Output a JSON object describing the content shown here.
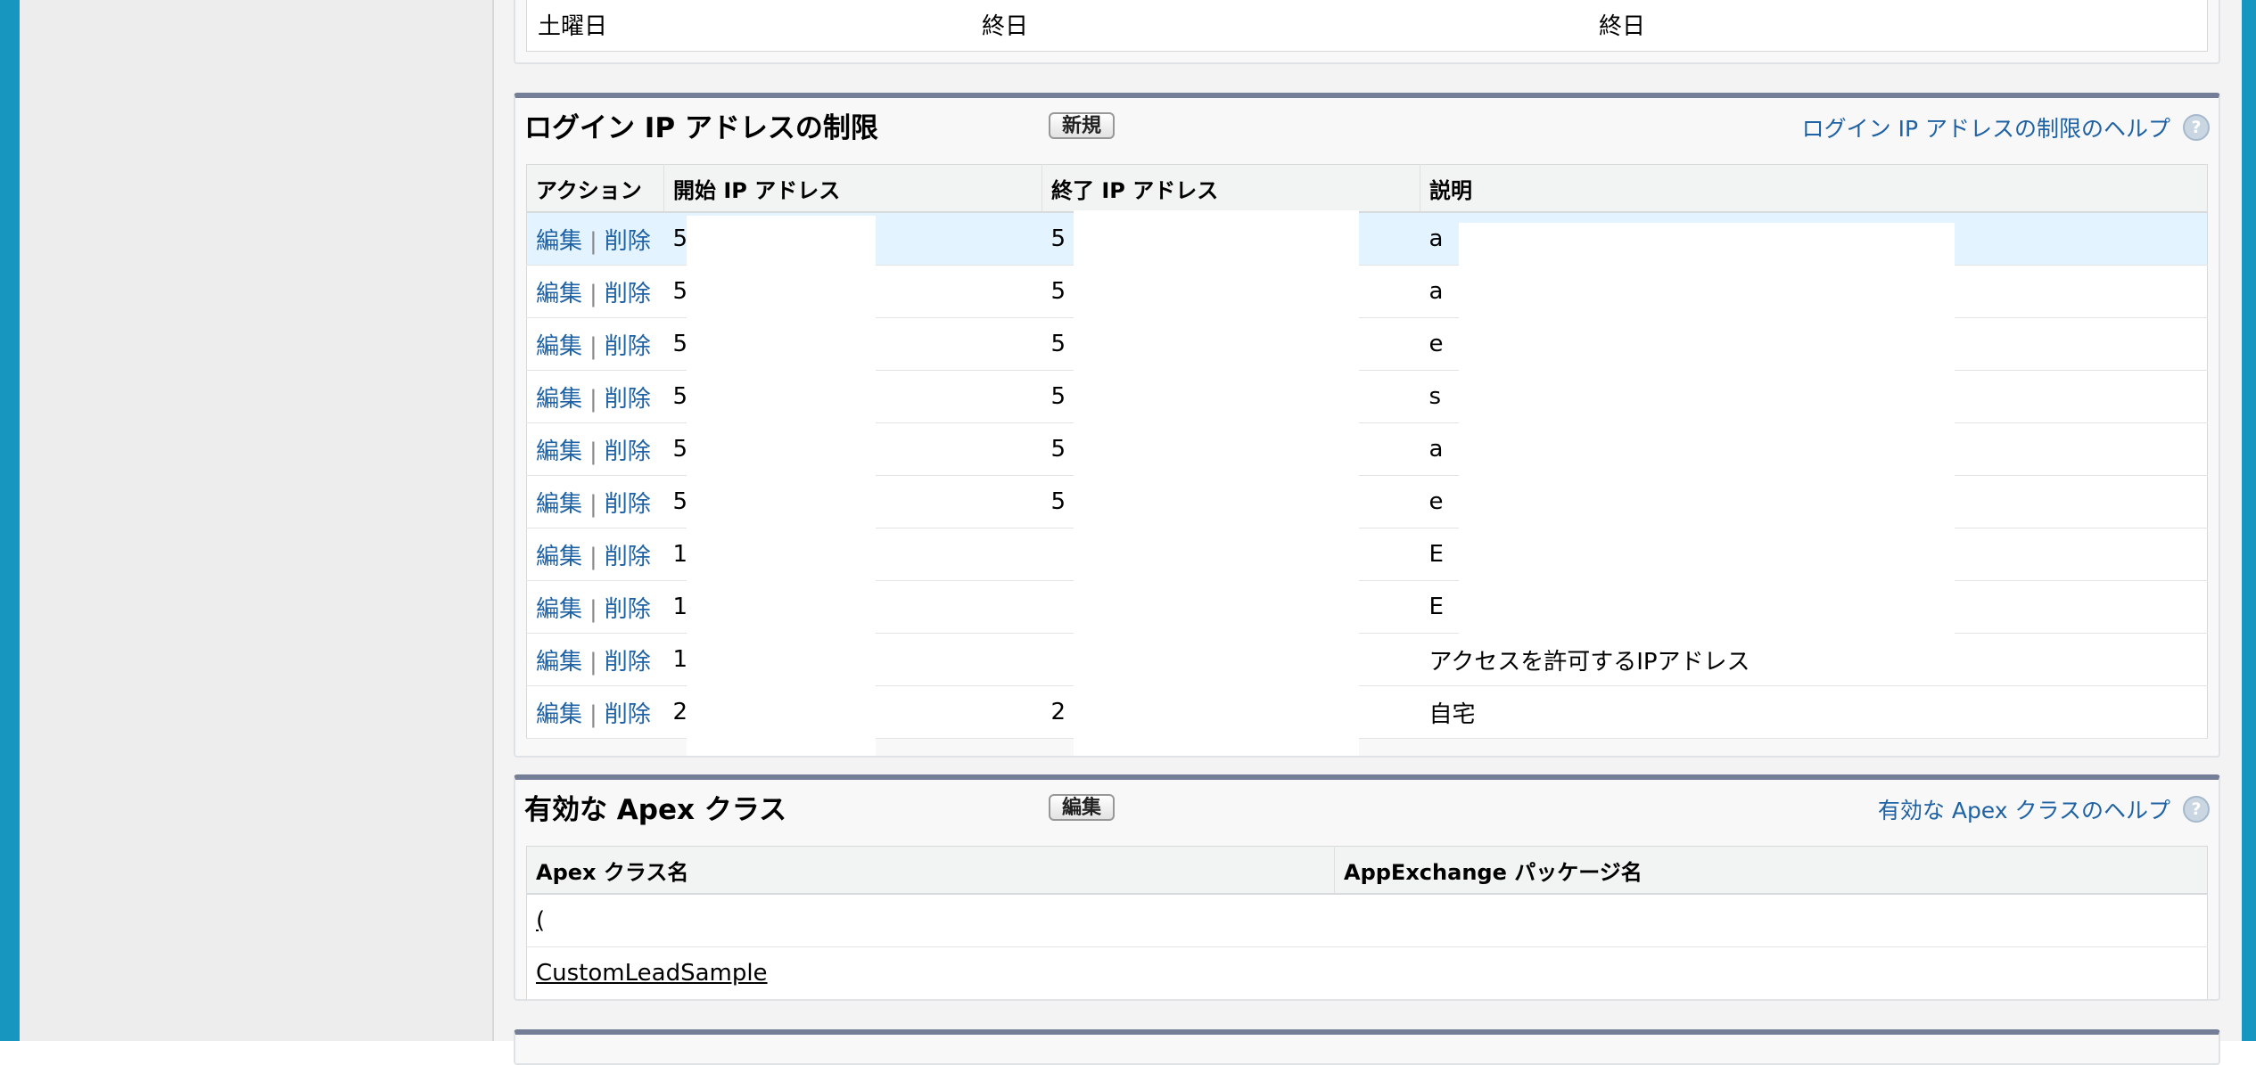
{
  "schedule_row": {
    "day": "土曜日",
    "start": "終日",
    "end": "終日"
  },
  "ip_section": {
    "title": "ログイン IP アドレスの制限",
    "new_button": "新規",
    "help_link": "ログイン IP アドレスの制限のヘルプ",
    "help_icon": "?",
    "columns": [
      "アクション",
      "開始 IP アドレス",
      "終了 IP アドレス",
      "説明"
    ],
    "edit_label": "編集",
    "separator": "|",
    "delete_label": "削除",
    "rows": [
      {
        "start": "5",
        "end": "5",
        "desc": "a"
      },
      {
        "start": "5",
        "end": "5",
        "desc": "a"
      },
      {
        "start": "5",
        "end": "5",
        "desc": "e"
      },
      {
        "start": "5",
        "end": "5",
        "desc": "s"
      },
      {
        "start": "5",
        "end": "5",
        "desc": "a"
      },
      {
        "start": "5",
        "end": "5",
        "desc": "e"
      },
      {
        "start": "1",
        "end": "",
        "desc": "E"
      },
      {
        "start": "1",
        "end": "",
        "desc": "E"
      },
      {
        "start": "1",
        "end": "",
        "desc": "アクセスを許可するIPアドレス"
      },
      {
        "start": "2",
        "end": "2",
        "desc": "自宅"
      }
    ]
  },
  "apex_section": {
    "title": "有効な Apex クラス",
    "edit_button": "編集",
    "help_link": "有効な Apex クラスのヘルプ",
    "help_icon": "?",
    "columns": [
      "Apex クラス名",
      "AppExchange パッケージ名"
    ],
    "rows": [
      {
        "name": "(",
        "package": ""
      },
      {
        "name": "CustomLeadSample",
        "package": ""
      }
    ]
  }
}
